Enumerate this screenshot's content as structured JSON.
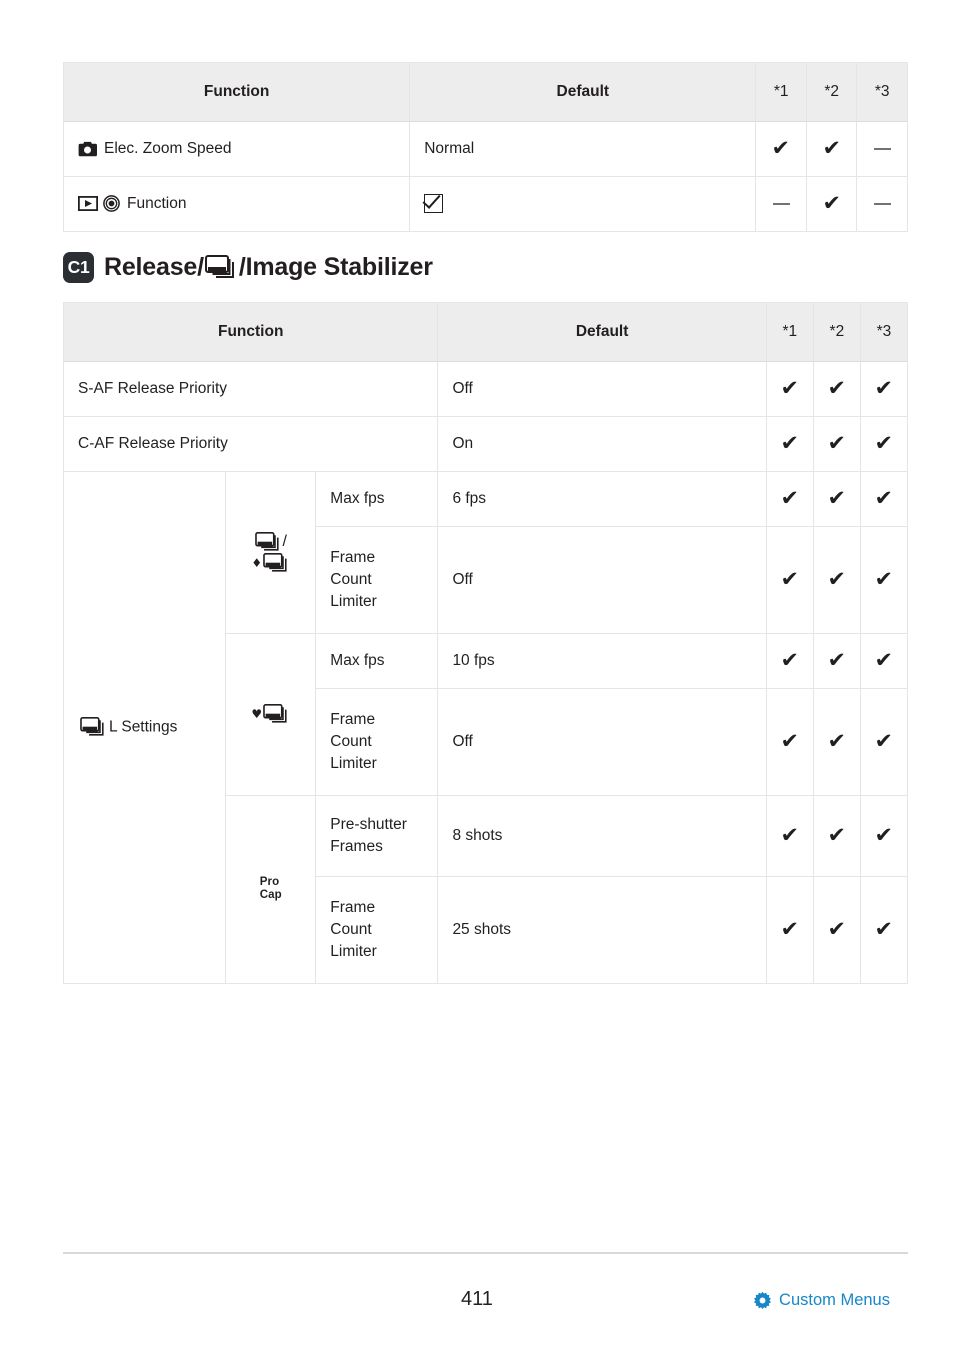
{
  "page": {
    "number": "411",
    "footer_link": "Custom Menus",
    "footer_icon": "gear-icon"
  },
  "table_top": {
    "headers": {
      "function": "Function",
      "default": "Default",
      "star1": "*1",
      "star2": "*2",
      "star3": "*3"
    },
    "rows": [
      {
        "icons": [
          "camera-icon"
        ],
        "function": "Elec. Zoom Speed",
        "default": "Normal",
        "default_type": "text",
        "star1": "check",
        "star2": "check",
        "star3": "dash"
      },
      {
        "icons": [
          "playback-icon",
          "record-icon"
        ],
        "function": "Function",
        "default": "",
        "default_type": "checkbox",
        "star1": "dash",
        "star2": "check",
        "star3": "dash"
      }
    ]
  },
  "section": {
    "badge": "C1",
    "title_before": "Release/",
    "title_icon": "burst-drive-icon",
    "title_after": "/Image Stabilizer"
  },
  "table_main": {
    "headers": {
      "function": "Function",
      "default": "Default",
      "star1": "*1",
      "star2": "*2",
      "star3": "*3"
    },
    "simple_rows": [
      {
        "function": "S-AF Release Priority",
        "default": "Off",
        "star1": "check",
        "star2": "check",
        "star3": "check"
      },
      {
        "function": "C-AF Release Priority",
        "default": "On",
        "star1": "check",
        "star2": "check",
        "star3": "check"
      }
    ],
    "group": {
      "label": "L Settings",
      "label_icon": "burst-drive-icon",
      "subgroups": [
        {
          "icon_top": "burst-drive-icon",
          "icon_top_suffix": "/",
          "icon_bottom_prefix": "♦",
          "icon_bottom": "burst-drive-icon",
          "icon_name": "sequential-low-drive-icon",
          "rows": [
            {
              "name": "Max fps",
              "default": "6 fps",
              "star1": "check",
              "star2": "check",
              "star3": "check"
            },
            {
              "name": "Frame Count Limiter",
              "default": "Off",
              "star1": "check",
              "star2": "check",
              "star3": "check"
            }
          ]
        },
        {
          "icon_bottom_prefix": "♥",
          "icon_bottom": "burst-drive-icon",
          "icon_name": "silent-drive-icon",
          "rows": [
            {
              "name": "Max fps",
              "default": "10 fps",
              "star1": "check",
              "star2": "check",
              "star3": "check"
            },
            {
              "name": "Frame Count Limiter",
              "default": "Off",
              "star1": "check",
              "star2": "check",
              "star3": "check"
            }
          ]
        },
        {
          "icon_text_line1": "Pro",
          "icon_text_line2": "Cap",
          "icon_name": "pro-capture-icon",
          "rows": [
            {
              "name": "Pre-shutter Frames",
              "default": "8 shots",
              "star1": "check",
              "star2": "check",
              "star3": "check"
            },
            {
              "name": "Frame Count Limiter",
              "default": "25 shots",
              "star1": "check",
              "star2": "check",
              "star3": "check"
            }
          ]
        }
      ]
    }
  },
  "colors": {
    "header_bg": "#ededed",
    "border": "#e2e5e9",
    "text": "#231f20",
    "link": "#1787c8",
    "badge_bg": "#2b2f33"
  }
}
